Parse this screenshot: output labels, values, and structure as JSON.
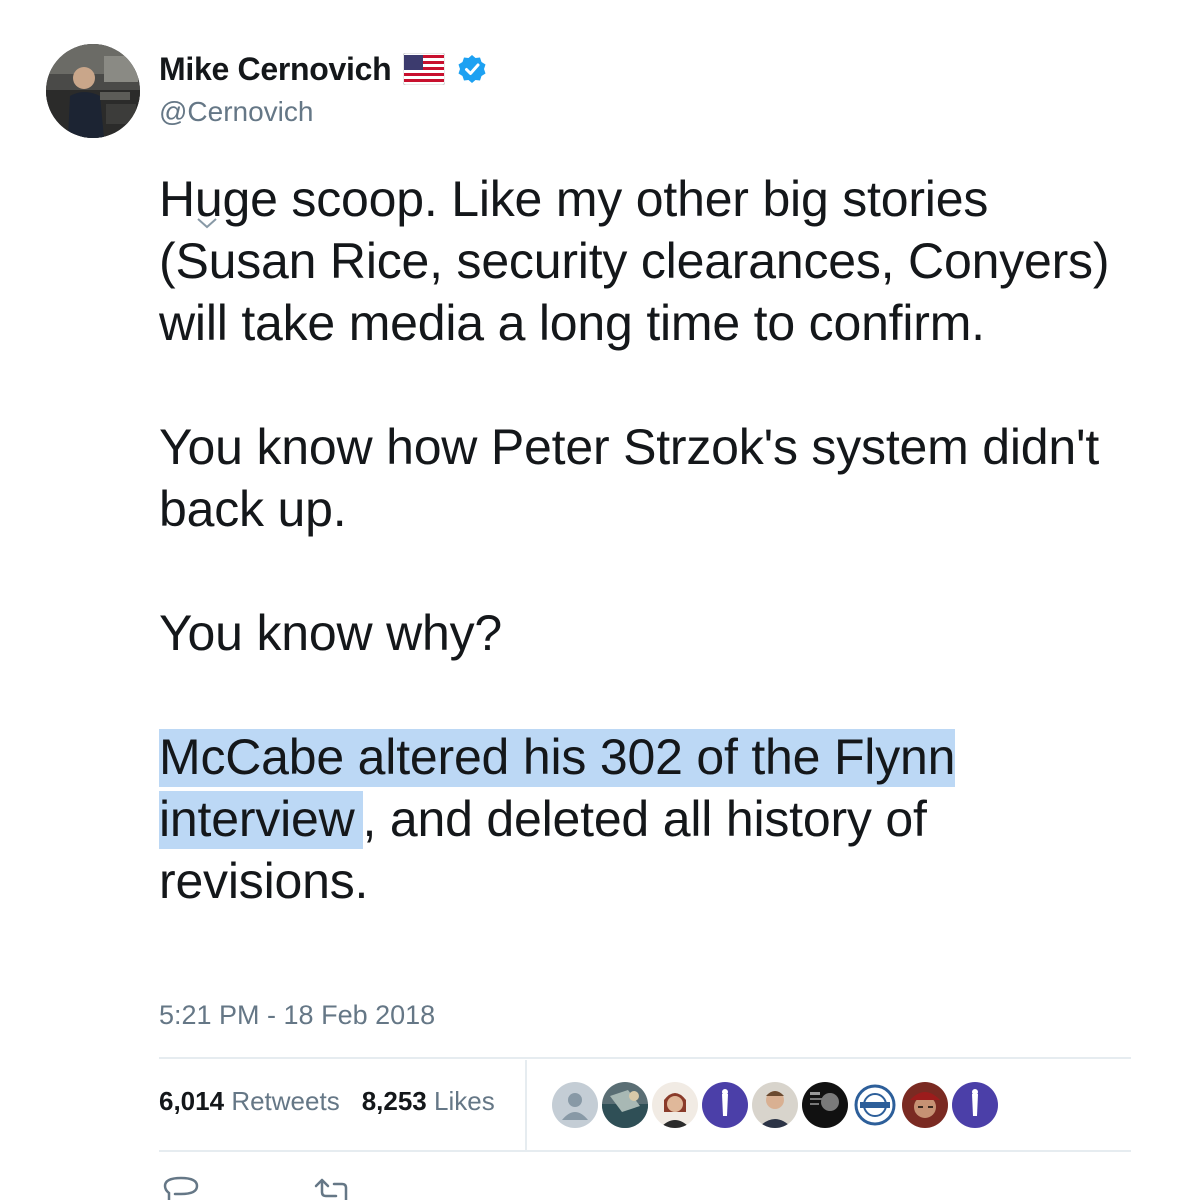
{
  "tweet": {
    "author": {
      "display_name": "Mike Cernovich",
      "handle": "@Cernovich"
    },
    "text": {
      "paragraph_1": "Huge scoop. Like my other big stories (Susan Rice, security clearances, Conyers) will take media a long time to confirm.",
      "paragraph_2": "You know how Peter Strzok's system didn't back up.",
      "paragraph_3": "You know why?",
      "paragraph_4_highlighted": "McCabe altered his 302 of the Flynn interview",
      "paragraph_4_rest": ", and deleted all history of revisions."
    },
    "timestamp": "5:21 PM - 18 Feb 2018",
    "stats": {
      "retweets_count": "6,014",
      "retweets_label": "Retweets",
      "likes_count": "8,253",
      "likes_label": "Likes"
    },
    "liked_by_avatars": [
      "default-profile-icon",
      "photo-avatar",
      "photo-avatar",
      "purple-avatar",
      "photo-avatar",
      "black-avatar",
      "logo-avatar",
      "photo-avatar",
      "purple-avatar"
    ]
  },
  "colors": {
    "text_primary": "#14171a",
    "text_secondary": "#657786",
    "verified_blue": "#1da1f2",
    "selection_highlight": "#bcd8f5",
    "divider": "#e6ecf0"
  }
}
